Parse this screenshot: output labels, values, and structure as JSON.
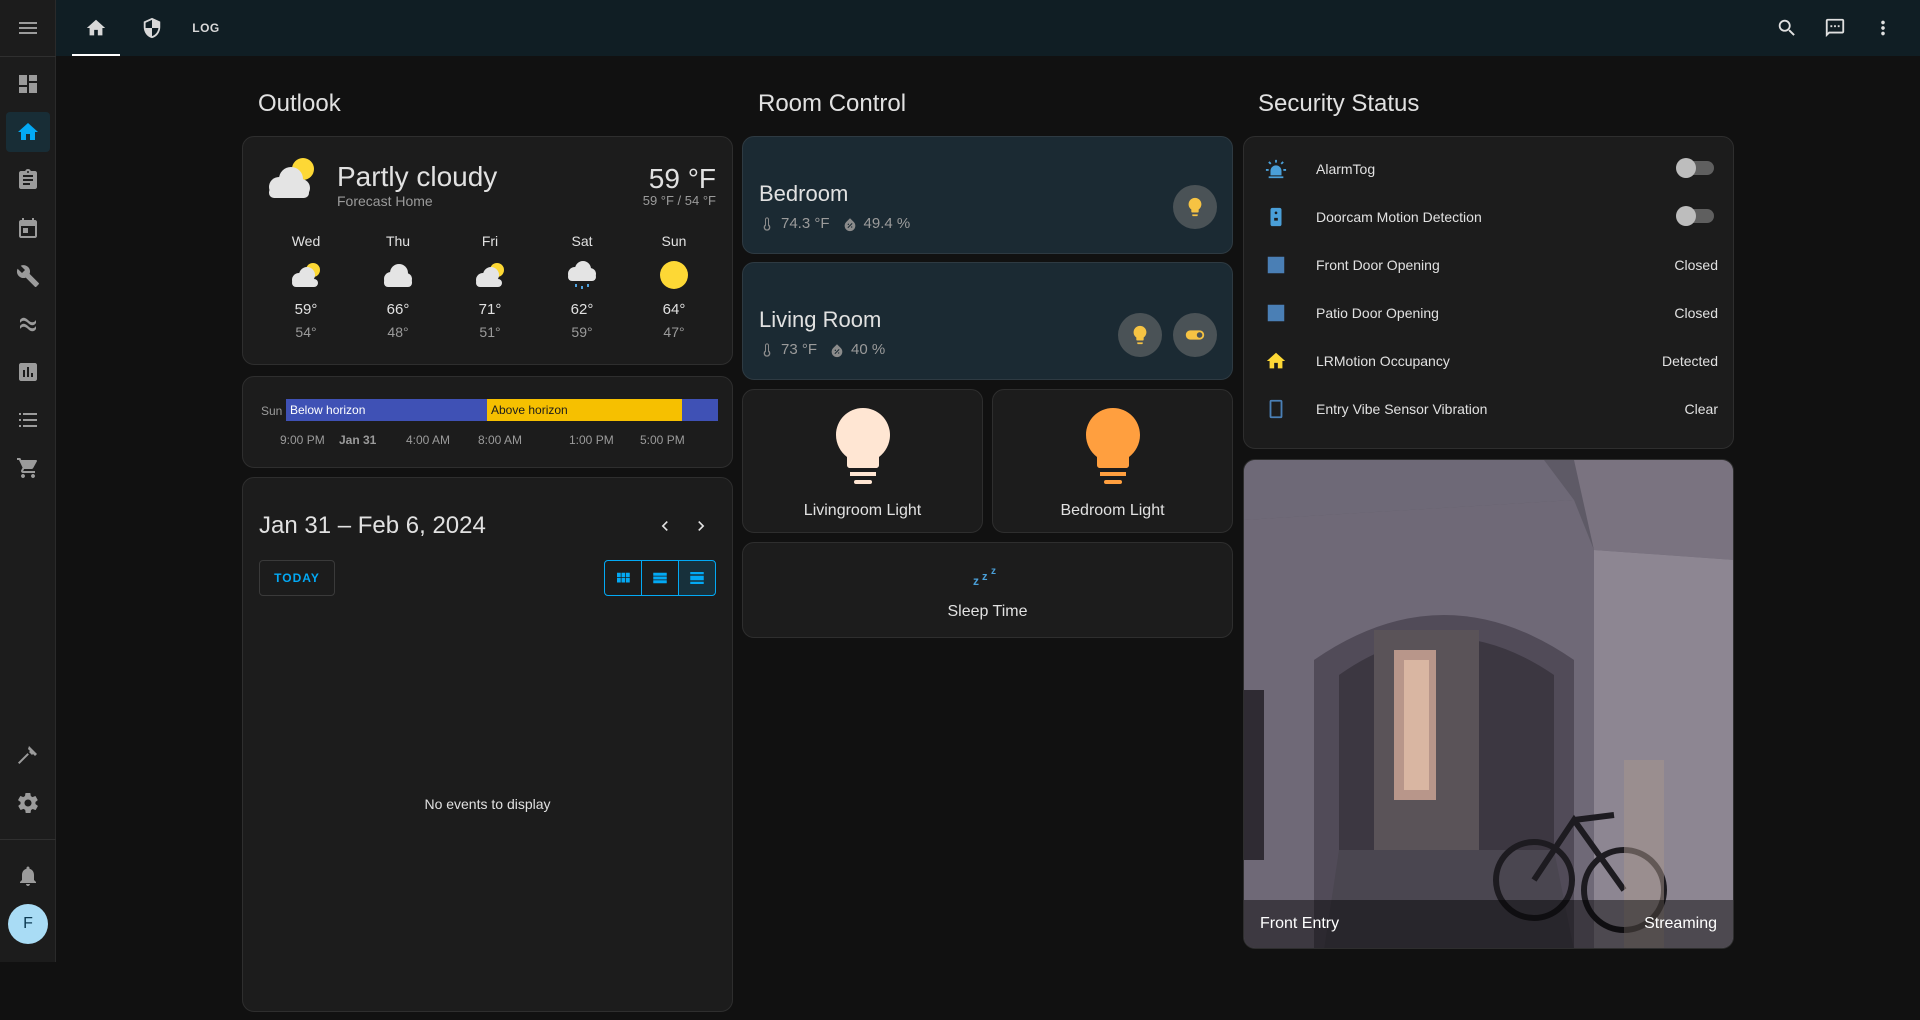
{
  "topbar": {
    "tabs": [
      {
        "icon": "home-icon"
      },
      {
        "icon": "shield-icon"
      },
      {
        "label": "LOG"
      }
    ]
  },
  "sidebar": {
    "items": [
      "menu-icon",
      "dashboard-icon",
      "home-icon",
      "clipboard-icon",
      "calendar-icon",
      "wrench-icon",
      "integration-icon",
      "chart-icon",
      "list-icon",
      "cart-icon",
      "hammer-icon",
      "gear-icon",
      "bell-icon"
    ],
    "active_color": "#03a9f4",
    "user_initial": "F"
  },
  "columns": {
    "outlook": "Outlook",
    "room_control": "Room Control",
    "security": "Security Status"
  },
  "weather": {
    "condition": "Partly cloudy",
    "location": "Forecast Home",
    "temperature": "59 °F",
    "range": "59 °F / 54 °F",
    "forecast": [
      {
        "day": "Wed",
        "icon": "partly-cloudy-icon",
        "high": "59°",
        "low": "54°"
      },
      {
        "day": "Thu",
        "icon": "cloudy-icon",
        "high": "66°",
        "low": "48°"
      },
      {
        "day": "Fri",
        "icon": "partly-cloudy-icon",
        "high": "71°",
        "low": "51°"
      },
      {
        "day": "Sat",
        "icon": "rainy-icon",
        "high": "62°",
        "low": "59°"
      },
      {
        "day": "Sun",
        "icon": "sunny-icon",
        "high": "64°",
        "low": "47°"
      }
    ]
  },
  "sun": {
    "label": "Sun",
    "below": "Below horizon",
    "above": "Above horizon",
    "below_color": "#3f51b5",
    "above_color": "#f6c000",
    "ticks": [
      "9:00 PM",
      "Jan 31",
      "4:00 AM",
      "8:00 AM",
      "1:00 PM",
      "5:00 PM"
    ]
  },
  "calendar": {
    "range": "Jan 31 – Feb 6, 2024",
    "today": "TODAY",
    "empty": "No events to display"
  },
  "rooms": [
    {
      "name": "Bedroom",
      "temp": "74.3 °F",
      "humidity": "49.4 %"
    },
    {
      "name": "Living Room",
      "temp": "73 °F",
      "humidity": "40 %"
    }
  ],
  "lights": [
    {
      "name": "Livingroom Light",
      "color": "#ffe6d3"
    },
    {
      "name": "Bedroom Light",
      "color": "#ff9f3f"
    }
  ],
  "scene": {
    "name": "Sleep Time"
  },
  "security": [
    {
      "icon": "alarm-light-icon",
      "label": "AlarmTog",
      "type": "toggle",
      "on": false
    },
    {
      "icon": "doorbell-icon",
      "label": "Doorcam Motion Detection",
      "type": "toggle",
      "on": false
    },
    {
      "icon": "door-square-icon",
      "label": "Front Door Opening",
      "state": "Closed"
    },
    {
      "icon": "door-square-icon",
      "label": "Patio Door Opening",
      "state": "Closed"
    },
    {
      "icon": "home-occupied-icon",
      "label": "LRMotion Occupancy",
      "state": "Detected"
    },
    {
      "icon": "vibration-icon",
      "label": "Entry Vibe Sensor Vibration",
      "state": "Clear"
    }
  ],
  "camera": {
    "name": "Front Entry",
    "state": "Streaming"
  }
}
